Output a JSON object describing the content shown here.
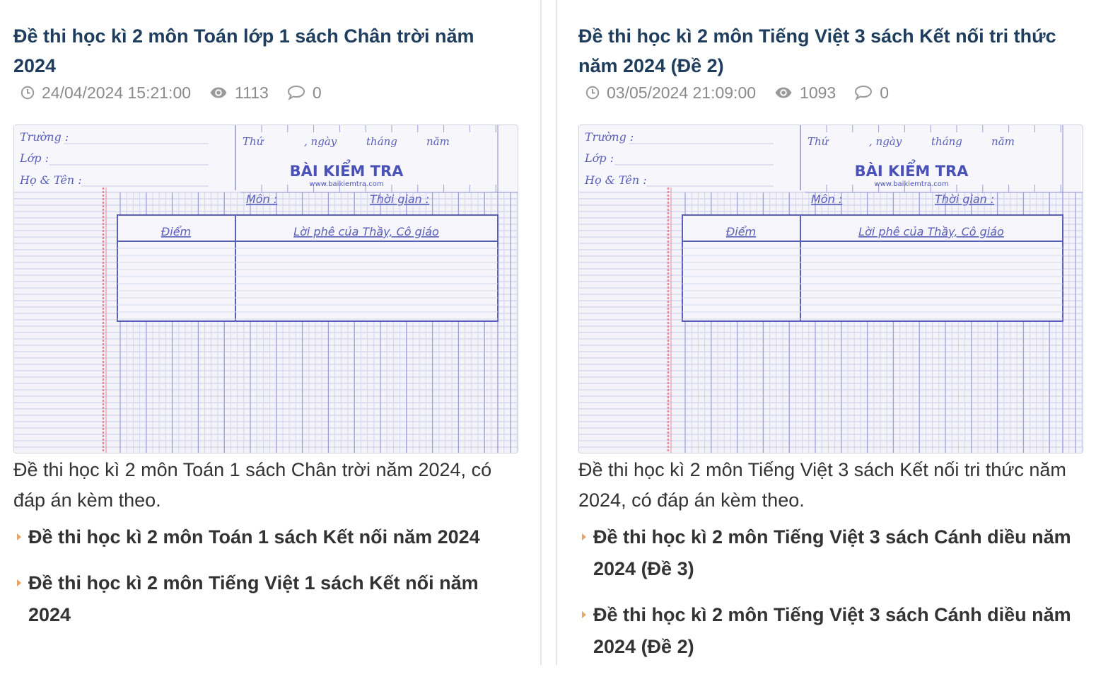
{
  "articles": [
    {
      "title": "Đề thi học kì 2 môn Toán lớp 1 sách Chân trời năm 2024",
      "date": "24/04/2024 15:21:00",
      "views": "1113",
      "comments": "0",
      "thumbnail": {
        "truong": "Trường :",
        "lop": "Lớp :",
        "ho_ten": "Họ & Tên :",
        "thu": "Thứ",
        "ngay": ", ngày",
        "thang": "tháng",
        "nam": "năm",
        "brand": "BÀI KIỂM TRA",
        "url": "www.baikiemtra.com",
        "mon": "Môn :",
        "thoi_gian": "Thời gian :",
        "diem": "Điểm",
        "loi_phe": "Lời phê của Thầy, Cô giáo"
      },
      "summary": "Đề thi học kì 2 môn Toán 1 sách Chân trời năm 2024, có đáp án kèm theo.",
      "related": [
        "Đề thi học kì 2 môn Toán 1 sách Kết nối năm 2024",
        "Đề thi học kì 2 môn Tiếng Việt 1 sách Kết nối năm 2024"
      ]
    },
    {
      "title": "Đề thi học kì 2 môn Tiếng Việt 3 sách Kết nối tri thức năm 2024 (Đề 2)",
      "date": "03/05/2024 21:09:00",
      "views": "1093",
      "comments": "0",
      "thumbnail": {
        "truong": "Trường :",
        "lop": "Lớp :",
        "ho_ten": "Họ & Tên :",
        "thu": "Thứ",
        "ngay": ", ngày",
        "thang": "tháng",
        "nam": "năm",
        "brand": "BÀI KIỂM TRA",
        "url": "www.baikiemtra.com",
        "mon": "Môn :",
        "thoi_gian": "Thời gian :",
        "diem": "Điểm",
        "loi_phe": "Lời phê của Thầy, Cô giáo"
      },
      "summary": "Đề thi học kì 2 môn Tiếng Việt 3 sách Kết nối tri thức năm 2024, có đáp án kèm theo.",
      "related": [
        "Đề thi học kì 2 môn Tiếng Việt 3 sách Cánh diều năm 2024 (Đề 3)",
        "Đề thi học kì 2 môn Tiếng Việt 3 sách Cánh diều năm 2024 (Đề 2)"
      ]
    }
  ],
  "icons": {
    "date": "clock-icon",
    "views": "eye-icon",
    "comments": "comment-icon",
    "bullet": "caret-right-icon"
  },
  "colors": {
    "title": "#1f3d5c",
    "meta": "#8a8a8a",
    "text": "#333333",
    "bullet": "#e7a56a",
    "paper_ink": "#5a5fb8",
    "margin_line": "#e58a9a"
  }
}
